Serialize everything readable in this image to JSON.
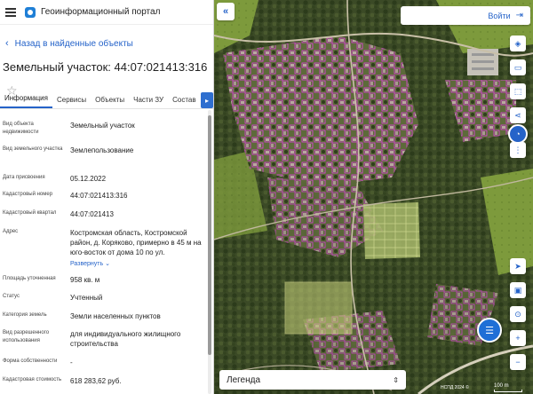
{
  "app": {
    "title": "Геоинформационный портал",
    "brand_color": "#1f7fd6",
    "accent_color": "#2563c9"
  },
  "nav": {
    "back_label": "Назад в найденные объекты"
  },
  "object": {
    "title": "Земельный участок: 44:07:021413:316"
  },
  "tabs": [
    {
      "label": "Информация",
      "active": true
    },
    {
      "label": "Сервисы",
      "active": false
    },
    {
      "label": "Объекты",
      "active": false
    },
    {
      "label": "Части ЗУ",
      "active": false
    },
    {
      "label": "Состав",
      "active": false
    }
  ],
  "properties": [
    {
      "label": "Вид объекта недвижимости",
      "value": "Земельный участок"
    },
    {
      "label": "Вид земельного участка",
      "value": "Землепользование"
    },
    {
      "label": "Дата присвоения",
      "value": "05.12.2022"
    },
    {
      "label": "Кадастровый номер",
      "value": "44:07:021413:316"
    },
    {
      "label": "Кадастровый квартал",
      "value": "44:07:021413"
    },
    {
      "label": "Адрес",
      "value": "Костромская область, Костромской район, д. Коряково, примерно в 45 м на юго-восток от дома 10 по ул."
    },
    {
      "label": "Площадь уточненная",
      "value": "958 кв. м"
    },
    {
      "label": "Статус",
      "value": "Учтенный"
    },
    {
      "label": "Категория земель",
      "value": "Земли населенных пунктов"
    },
    {
      "label": "Вид разрешенного использования",
      "value": "для индивидуального жилищного строительства"
    },
    {
      "label": "Форма собственности",
      "value": "-"
    },
    {
      "label": "Кадастровая стоимость",
      "value": "618 283,62 руб."
    }
  ],
  "address_expand_label": "Развернуть",
  "map": {
    "login_label": "Войти",
    "legend_label": "Легенда",
    "attribution": "НСПД 2024 ©",
    "scale_label": "100 m"
  }
}
